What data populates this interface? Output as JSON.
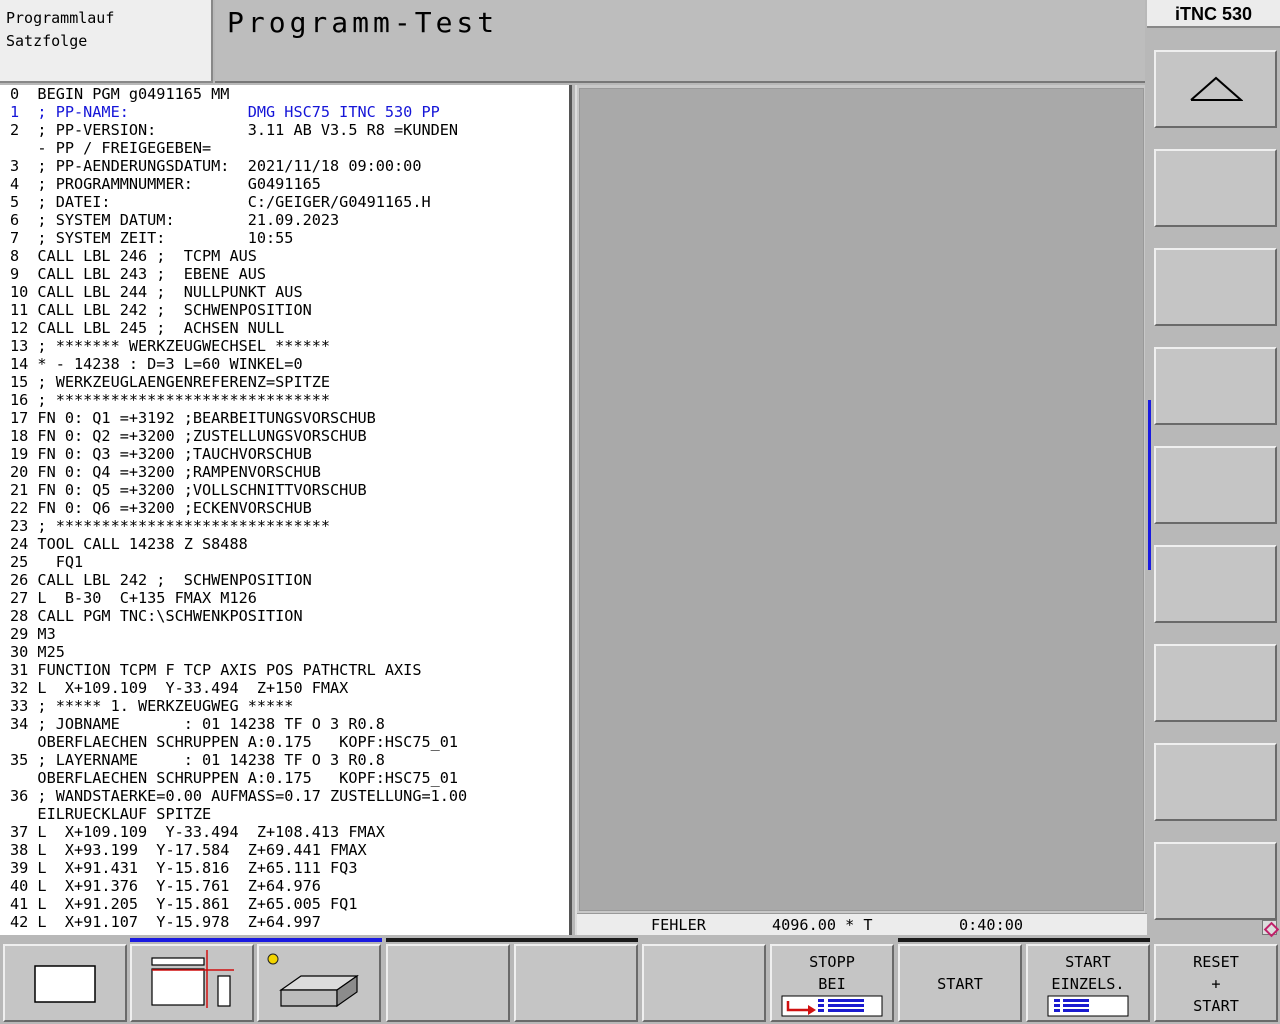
{
  "mode": {
    "line1": "Programmlauf",
    "line2": "Satzfolge"
  },
  "title": "Programm-Test",
  "brand": "iTNC 530",
  "program": {
    "active_line": 1,
    "lines": [
      "0  BEGIN PGM g0491165 MM",
      "1  ; PP-NAME:             DMG HSC75 ITNC 530 PP",
      "2  ; PP-VERSION:          3.11 AB V3.5 R8 =KUNDEN",
      "   - PP / FREIGEGEBEN=",
      "3  ; PP-AENDERUNGSDATUM:  2021/11/18 09:00:00",
      "4  ; PROGRAMMNUMMER:      G0491165",
      "5  ; DATEI:               C:/GEIGER/G0491165.H",
      "6  ; SYSTEM DATUM:        21.09.2023",
      "7  ; SYSTEM ZEIT:         10:55",
      "8  CALL LBL 246 ;  TCPM AUS",
      "9  CALL LBL 243 ;  EBENE AUS",
      "10 CALL LBL 244 ;  NULLPUNKT AUS",
      "11 CALL LBL 242 ;  SCHWENPOSITION",
      "12 CALL LBL 245 ;  ACHSEN NULL",
      "13 ; ******* WERKZEUGWECHSEL ******",
      "14 * - 14238 : D=3 L=60 WINKEL=0",
      "15 ; WERKZEUGLAENGENREFERENZ=SPITZE",
      "16 ; ******************************",
      "17 FN 0: Q1 =+3192 ;BEARBEITUNGSVORSCHUB",
      "18 FN 0: Q2 =+3200 ;ZUSTELLUNGSVORSCHUB",
      "19 FN 0: Q3 =+3200 ;TAUCHVORSCHUB",
      "20 FN 0: Q4 =+3200 ;RAMPENVORSCHUB",
      "21 FN 0: Q5 =+3200 ;VOLLSCHNITTVORSCHUB",
      "22 FN 0: Q6 =+3200 ;ECKENVORSCHUB",
      "23 ; ******************************",
      "24 TOOL CALL 14238 Z S8488",
      "25   FQ1",
      "26 CALL LBL 242 ;  SCHWENPOSITION",
      "27 L  B-30  C+135 FMAX M126",
      "28 CALL PGM TNC:\\SCHWENKPOSITION",
      "29 M3",
      "30 M25",
      "31 FUNCTION TCPM F TCP AXIS POS PATHCTRL AXIS",
      "32 L  X+109.109  Y-33.494  Z+150 FMAX",
      "33 ; ***** 1. WERKZEUGWEG *****",
      "34 ; JOBNAME       : 01 14238 TF O 3 R0.8",
      "   OBERFLAECHEN SCHRUPPEN A:0.175   KOPF:HSC75_01",
      "35 ; LAYERNAME     : 01 14238 TF O 3 R0.8",
      "   OBERFLAECHEN SCHRUPPEN A:0.175   KOPF:HSC75_01",
      "36 ; WANDSTAERKE=0.00 AUFMASS=0.17 ZUSTELLUNG=1.00",
      "   EILRUECKLAUF SPITZE",
      "37 L  X+109.109  Y-33.494  Z+108.413 FMAX",
      "38 L  X+93.199  Y-17.584  Z+69.441 FMAX",
      "39 L  X+91.431  Y-15.816  Z+65.111 FQ3",
      "40 L  X+91.376  Y-15.761  Z+64.976",
      "41 L  X+91.205  Y-15.861  Z+65.005 FQ1",
      "42 L  X+91.107  Y-15.978  Z+64.997"
    ]
  },
  "status": {
    "error": "FEHLER",
    "value": "4096.00 * T",
    "time": "0:40:00"
  },
  "softkeys": {
    "stopp_line1": "STOPP",
    "stopp_line2": "BEI",
    "start": "START",
    "start_einzel_line1": "START",
    "start_einzel_line2": "EINZELS.",
    "reset_line1": "RESET",
    "reset_line2": "+",
    "reset_line3": "START"
  },
  "icons": {
    "vertical_1": "page-up-arrow-icon",
    "screen_layout_1": "single-window-icon",
    "screen_layout_2": "program-graphics-layout-icon",
    "screen_layout_3": "3d-workpiece-icon"
  },
  "colors": {
    "active_line": "#1515d8",
    "scroll_marker": "#1a1ae0"
  }
}
